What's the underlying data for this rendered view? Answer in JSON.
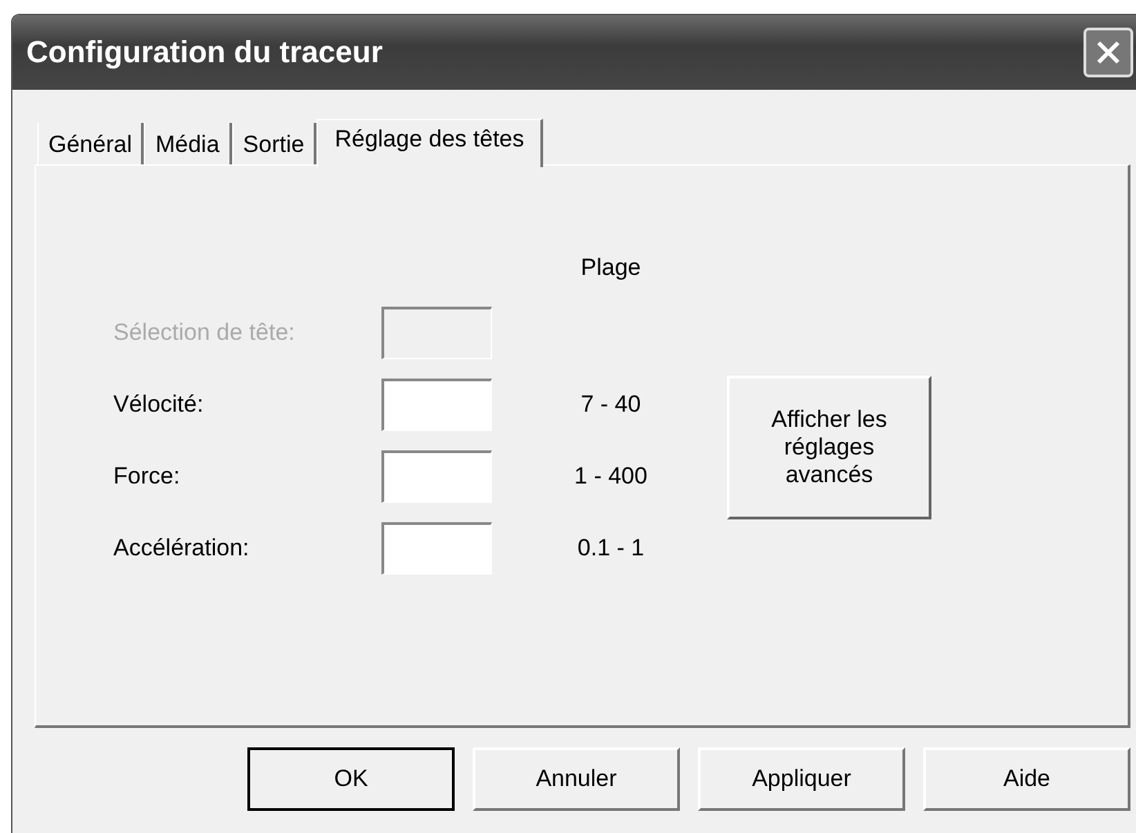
{
  "window": {
    "title": "Configuration du traceur"
  },
  "tabs": [
    {
      "label": "Général",
      "selected": false
    },
    {
      "label": "Média",
      "selected": false
    },
    {
      "label": "Sortie",
      "selected": false
    },
    {
      "label": "Réglage des têtes",
      "selected": true
    }
  ],
  "range_header": "Plage",
  "fields": [
    {
      "label": "Sélection de tête:",
      "disabled": true
    },
    {
      "label": "Vélocité:",
      "disabled": false,
      "range": "7 - 40"
    },
    {
      "label": "Force:",
      "disabled": false,
      "range": "1 - 400"
    },
    {
      "label": "Accélération:",
      "disabled": false,
      "range": "0.1 - 1"
    }
  ],
  "advanced_button": "Afficher les réglages avancés",
  "buttons": [
    {
      "label": "OK",
      "default": true
    },
    {
      "label": "Annuler",
      "default": false
    },
    {
      "label": "Appliquer",
      "default": false
    },
    {
      "label": "Aide",
      "default": false
    }
  ]
}
